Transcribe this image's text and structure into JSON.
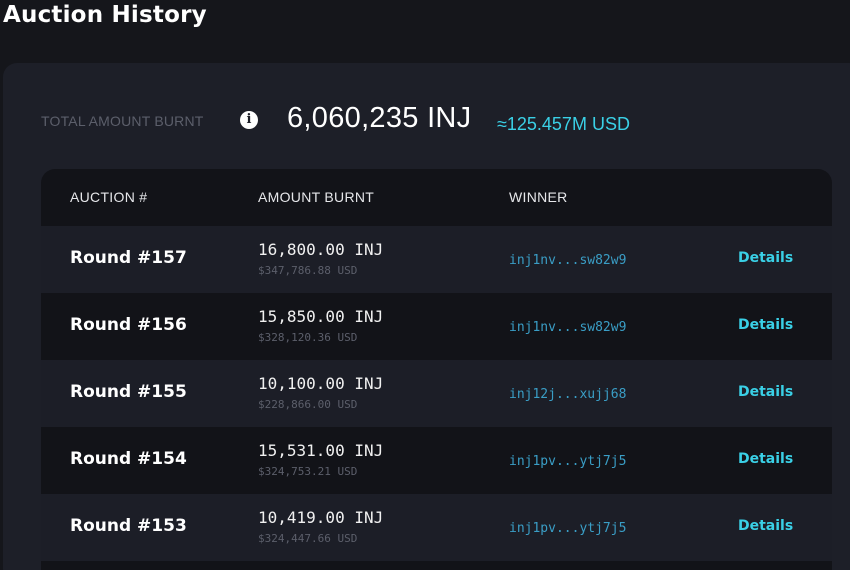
{
  "page": {
    "title": "Auction History"
  },
  "summary": {
    "label": "TOTAL AMOUNT BURNT",
    "info_icon": "i",
    "total": "6,060,235 INJ",
    "usd": "≈125.457M USD"
  },
  "table": {
    "headers": {
      "auction": "AUCTION #",
      "amount": "AMOUNT BURNT",
      "winner": "WINNER"
    },
    "rows": [
      {
        "round": "Round #157",
        "amount": "16,800.00 INJ",
        "usd": "$347,786.88 USD",
        "winner": "inj1nv...sw82w9",
        "details": "Details"
      },
      {
        "round": "Round #156",
        "amount": "15,850.00 INJ",
        "usd": "$328,120.36 USD",
        "winner": "inj1nv...sw82w9",
        "details": "Details"
      },
      {
        "round": "Round #155",
        "amount": "10,100.00 INJ",
        "usd": "$228,866.00 USD",
        "winner": "inj12j...xujj68",
        "details": "Details"
      },
      {
        "round": "Round #154",
        "amount": "15,531.00 INJ",
        "usd": "$324,753.21 USD",
        "winner": "inj1pv...ytj7j5",
        "details": "Details"
      },
      {
        "round": "Round #153",
        "amount": "10,419.00 INJ",
        "usd": "$324,447.66 USD",
        "winner": "inj1pv...ytj7j5",
        "details": "Details"
      }
    ]
  },
  "colors": {
    "background": "#15161b",
    "panel": "#1d1f28",
    "accent": "#3ad0e6",
    "winner_link": "#3a9ec6"
  }
}
